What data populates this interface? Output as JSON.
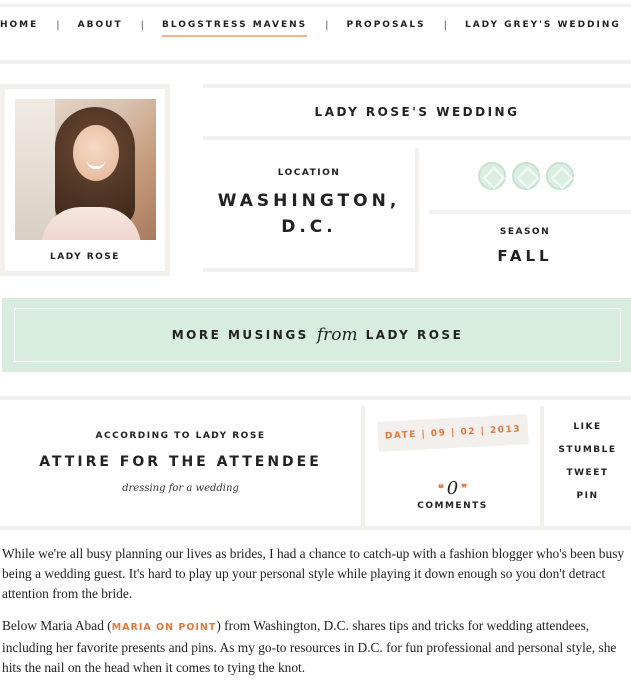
{
  "nav": {
    "items": [
      {
        "label": "HOME",
        "active": false
      },
      {
        "label": "ABOUT",
        "active": false
      },
      {
        "label": "BLOGSTRESS MAVENS",
        "active": true
      },
      {
        "label": "PROPOSALS",
        "active": false
      },
      {
        "label": "LADY GREY'S WEDDING",
        "active": false
      }
    ],
    "separator": "|"
  },
  "profile": {
    "name": "LADY ROSE"
  },
  "wedding": {
    "title": "LADY ROSE'S WEDDING",
    "location_label": "LOCATION",
    "location_line1": "WASHINGTON,",
    "location_line2": "D.C.",
    "season_label": "SEASON",
    "season_value": "FALL",
    "gem_count": 3
  },
  "musings": {
    "prefix": "MORE MUSINGS",
    "from": "from",
    "suffix": "LADY ROSE"
  },
  "article": {
    "according": "ACCORDING TO LADY ROSE",
    "title": "ATTIRE FOR THE ATTENDEE",
    "subtitle": "dressing for a wedding",
    "date_label": "DATE",
    "date_sep": "|",
    "date_month": "09",
    "date_day": "02",
    "date_year": "2013",
    "open_quote": "❝",
    "close_quote": "❞",
    "comment_count": "0",
    "comments_label": "COMMENTS",
    "share": [
      "LIKE",
      "STUMBLE",
      "TWEET",
      "PIN"
    ]
  },
  "body": {
    "p1": "While we're all busy planning our lives as brides, I had a chance to catch-up with a fashion blogger who's been busy being a wedding guest. It's hard to play up your personal style while playing it down enough so you don't detract attention from the bride.",
    "p2_before": "Below Maria Abad (",
    "p2_link": "MARIA ON POINT",
    "p2_after": ") from Washington, D.C. shares tips and tricks for wedding attendees, including her favorite presents and pins. As my go-to resources in D.C. for fun professional and personal style, she hits the nail on the head when it comes to tying the knot."
  },
  "colors": {
    "accent_orange": "#e07a3e",
    "mint_band": "#d8eddf",
    "border_beige": "#f2efec",
    "nav_underline": "#f0b48f"
  }
}
